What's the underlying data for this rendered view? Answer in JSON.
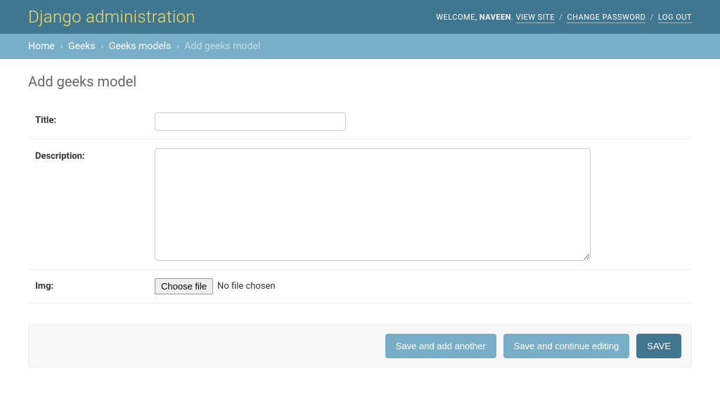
{
  "header": {
    "title": "Django administration",
    "welcome_prefix": "WELCOME, ",
    "username": "NAVEEN",
    "dot": ". ",
    "view_site": "VIEW SITE",
    "change_password": "CHANGE PASSWORD",
    "log_out": "LOG OUT",
    "slash": " / "
  },
  "breadcrumbs": {
    "home": "Home",
    "app": "Geeks",
    "model": "Geeks models",
    "current": "Add geeks model",
    "sep": "›"
  },
  "page_title": "Add geeks model",
  "form": {
    "title": {
      "label": "Title:",
      "value": ""
    },
    "description": {
      "label": "Description:",
      "value": ""
    },
    "img": {
      "label": "Img:",
      "choose_button": "Choose file",
      "status": "No file chosen"
    }
  },
  "actions": {
    "save_add": "Save and add another",
    "save_continue": "Save and continue editing",
    "save": "SAVE"
  }
}
